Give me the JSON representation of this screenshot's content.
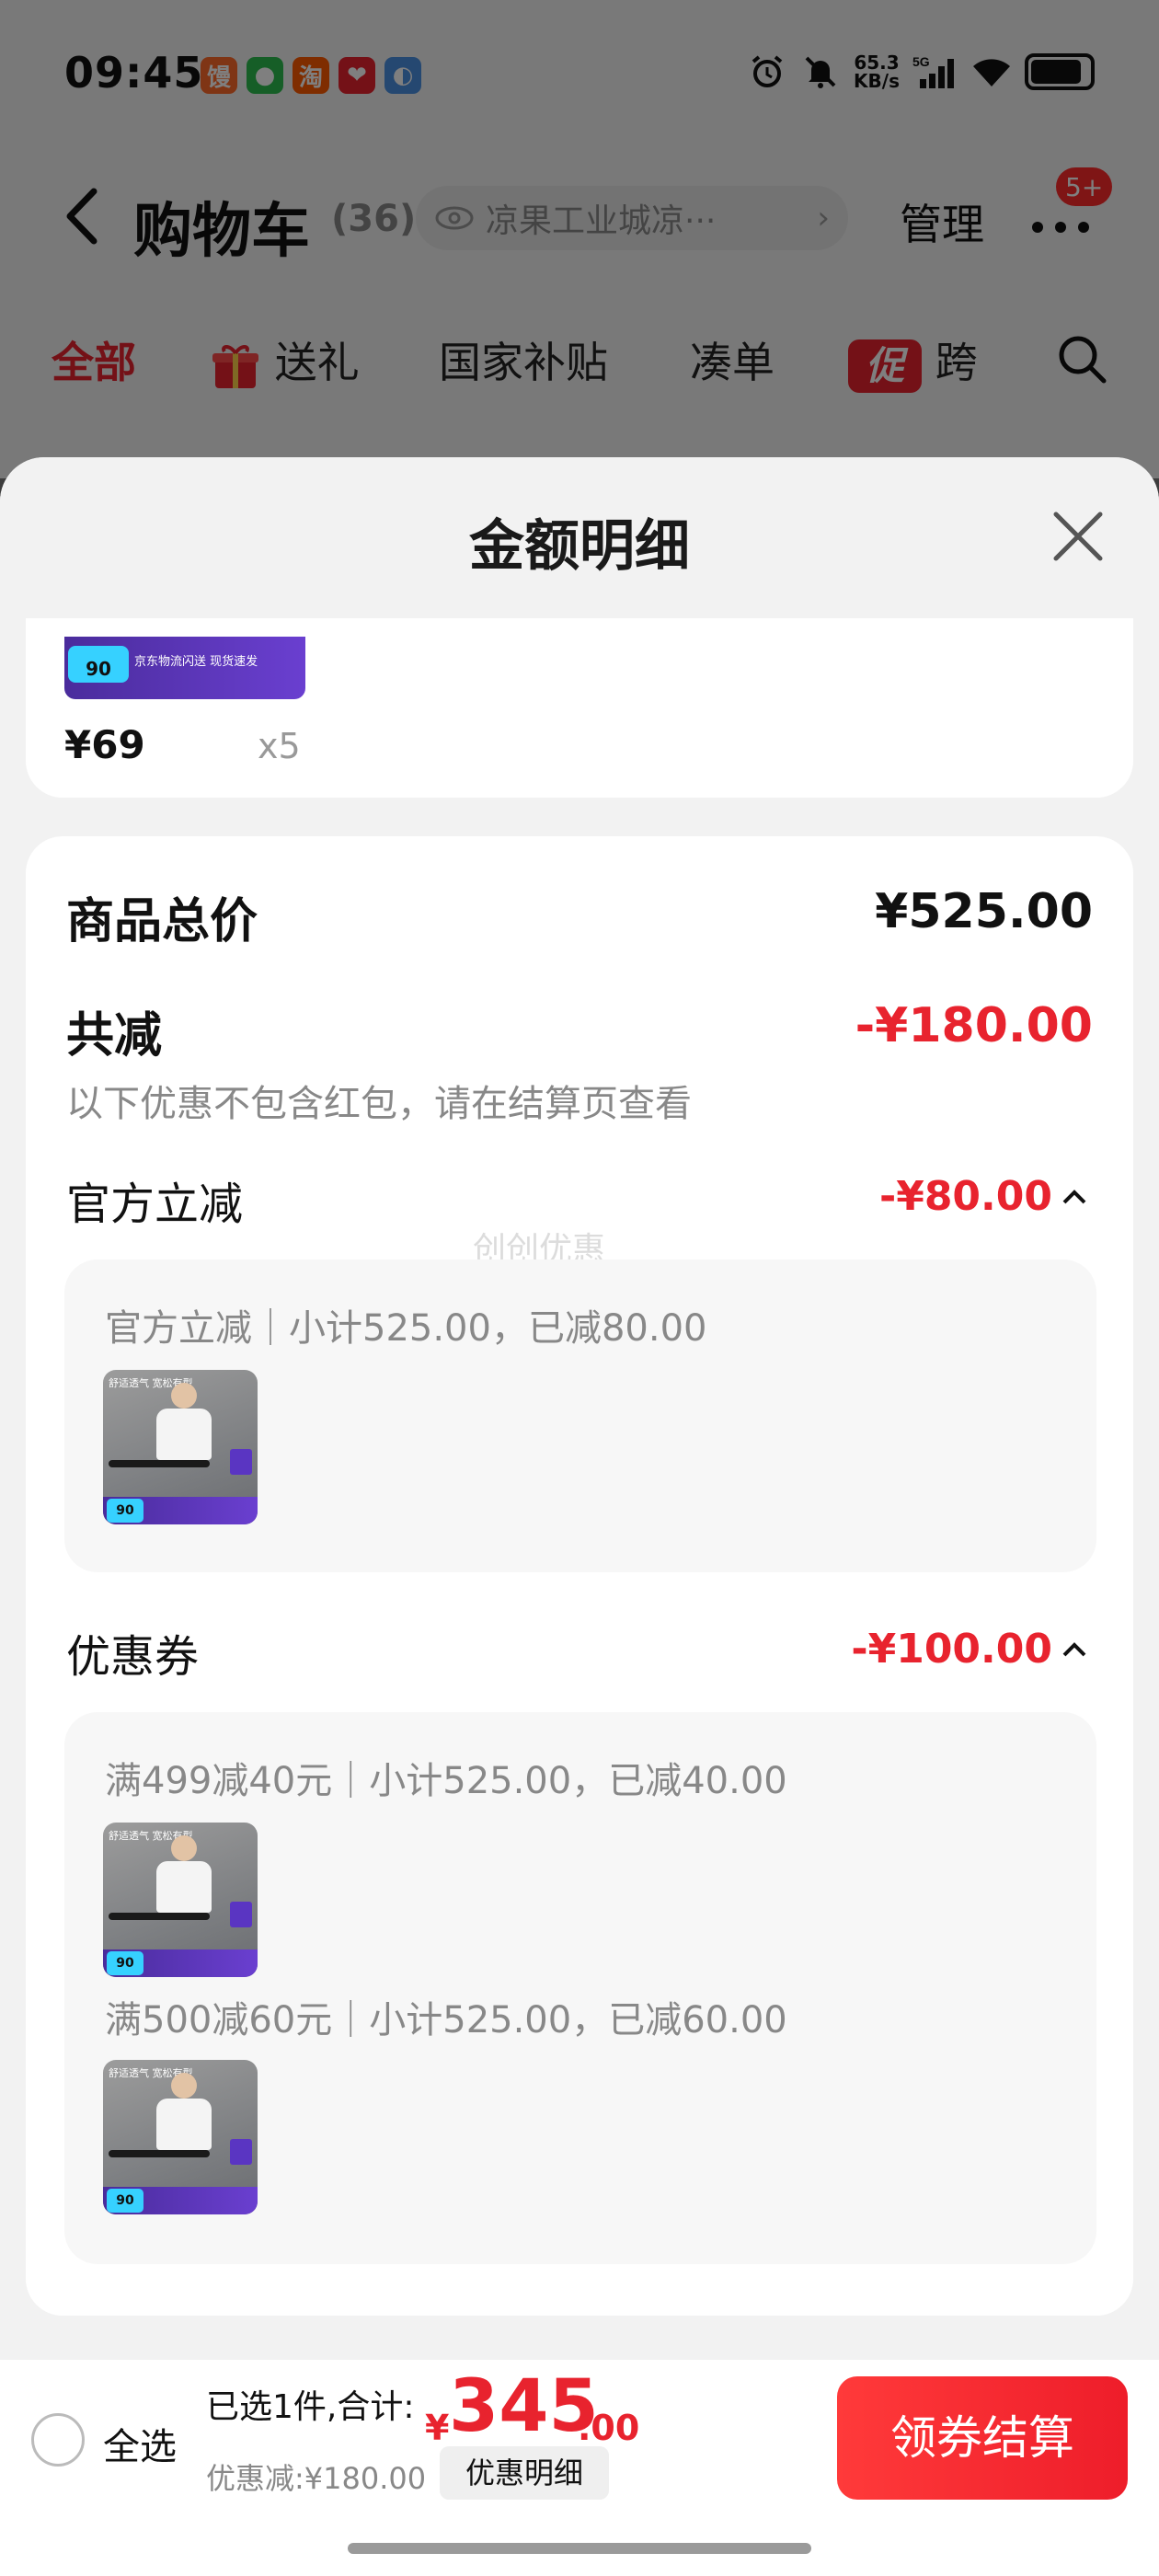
{
  "status_bar": {
    "time": "09:45",
    "notif_icons": [
      {
        "name": "app-icon-1",
        "glyph": "馒",
        "color": "#ff6a2b"
      },
      {
        "name": "wechat-icon",
        "glyph": "●",
        "color": "#2dbd4e"
      },
      {
        "name": "taobao-icon",
        "glyph": "淘",
        "color": "#ff5a00"
      },
      {
        "name": "app-icon-4",
        "glyph": "❤",
        "color": "#e8232e"
      },
      {
        "name": "app-icon-5",
        "glyph": "◐",
        "color": "#4a90e2"
      }
    ],
    "net_speed_value": "65.3",
    "net_speed_unit": "KB/s",
    "signal_label": "5G"
  },
  "nav": {
    "title": "购物车",
    "count": "(36)",
    "address": "凉果工业城凉···",
    "address_chevron": "›",
    "manage": "管理",
    "badge": "5+"
  },
  "tabs": [
    {
      "label": "全部",
      "active": true
    },
    {
      "label": "送礼"
    },
    {
      "label": "国家补贴"
    },
    {
      "label": "凑单"
    },
    {
      "label": "跨",
      "promo_tag": "促"
    }
  ],
  "sheet": {
    "title": "金额明细",
    "top_item": {
      "price": "¥69",
      "qty": "x5",
      "thumb_badge": "90",
      "thumb_text": "京东物流闪送 现货速发"
    },
    "totals": {
      "goods_total_label": "商品总价",
      "goods_total_value": "¥525.00",
      "reduction_label": "共减",
      "reduction_value": "-¥180.00",
      "reduction_note": "以下优惠不包含红包，请在结算页查看"
    },
    "watermark": "创创优惠",
    "sections": [
      {
        "label": "官方立减",
        "value": "-¥80.00",
        "details": [
          {
            "line": "官方立减｜小计525.00，已减80.00"
          }
        ]
      },
      {
        "label": "优惠券",
        "value": "-¥100.00",
        "details": [
          {
            "line": "满499减40元｜小计525.00，已减40.00"
          },
          {
            "line": "满500减60元｜小计525.00，已减60.00"
          }
        ]
      }
    ],
    "thumb_caption": "舒适透气 宽松有型",
    "thumb_badge": "90"
  },
  "bottom_bar": {
    "select_all": "全选",
    "summary_prefix": "已选1件,合计:",
    "currency": "¥",
    "total_int": "345",
    "total_dec": ".00",
    "discount": "优惠减:¥180.00",
    "detail_chip": "优惠明细",
    "checkout": "领券结算"
  },
  "colors": {
    "accent_red": "#e8232e",
    "sheet_bg": "#f2f2f2",
    "card_bg": "#ffffff"
  }
}
